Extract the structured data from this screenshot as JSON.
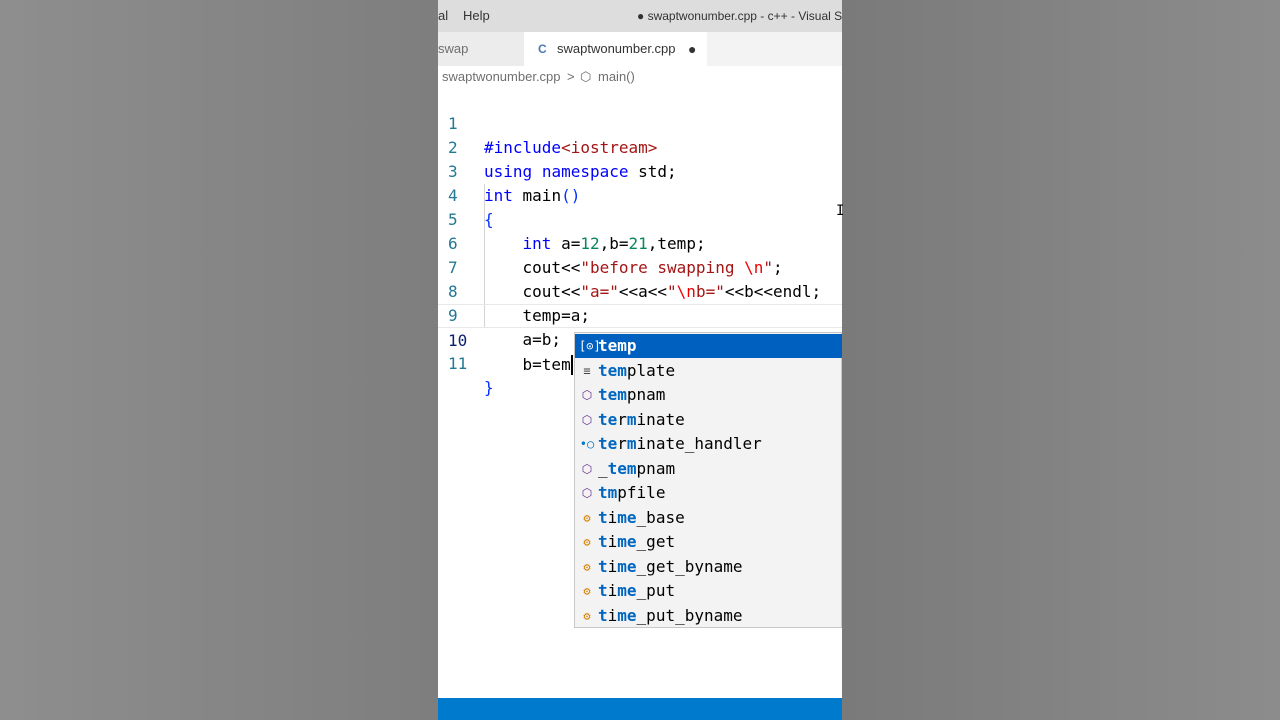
{
  "titlebar": {
    "menu_partial": "al",
    "menu_help": "Help",
    "title": "● swaptwonumber.cpp - c++ - Visual S"
  },
  "tabs": {
    "inactive_label": "swap",
    "active_icon": "C",
    "active_label": "swaptwonumber.cpp",
    "dirty_indicator": "●"
  },
  "breadcrumb": {
    "file": "swaptwonumber.cpp",
    "separator": ">",
    "symbol_icon": "⬡",
    "function": "main()"
  },
  "editor": {
    "line_numbers": [
      "1",
      "2",
      "3",
      "4",
      "5",
      "6",
      "7",
      "8",
      "9",
      "10",
      "11"
    ],
    "current_line": 10,
    "typed_text": "b=tem"
  },
  "suggestions": [
    {
      "icon": "variable-icon",
      "glyph": "[⊙]",
      "match": "temp",
      "rest": "",
      "selected": true
    },
    {
      "icon": "keyword-icon",
      "glyph": "≡",
      "match": "tem",
      "rest": "plate"
    },
    {
      "icon": "function-icon",
      "glyph": "⬡",
      "match": "tem",
      "rest": "pnam"
    },
    {
      "icon": "function-icon",
      "glyph": "⬡",
      "match": "te",
      "rest": "r",
      "match2": "m",
      "rest2": "inate"
    },
    {
      "icon": "field-icon",
      "glyph": "•○",
      "match": "te",
      "rest": "r",
      "match2": "m",
      "rest2": "inate_handler"
    },
    {
      "icon": "function-icon",
      "glyph": "⬡",
      "pre": "_",
      "match": "tem",
      "rest": "pnam"
    },
    {
      "icon": "function-icon",
      "glyph": "⬡",
      "match": "t",
      "rest": "",
      "match2": "m",
      "rest2": "pfile"
    },
    {
      "icon": "class-icon",
      "glyph": "⚙",
      "match": "t",
      "rest": "i",
      "match2": "me",
      "rest2": "_base"
    },
    {
      "icon": "class-icon",
      "glyph": "⚙",
      "match": "t",
      "rest": "i",
      "match2": "me",
      "rest2": "_get"
    },
    {
      "icon": "class-icon",
      "glyph": "⚙",
      "match": "t",
      "rest": "i",
      "match2": "me",
      "rest2": "_get_byname"
    },
    {
      "icon": "class-icon",
      "glyph": "⚙",
      "match": "t",
      "rest": "i",
      "match2": "me",
      "rest2": "_put"
    },
    {
      "icon": "class-icon",
      "glyph": "⚙",
      "match": "t",
      "rest": "i",
      "match2": "me",
      "rest2": "_put_byname"
    }
  ],
  "colors": {
    "statusbar": "#007acc",
    "selection": "#0060c0",
    "keyword": "#0000ff",
    "string": "#a31515",
    "number": "#098658"
  }
}
